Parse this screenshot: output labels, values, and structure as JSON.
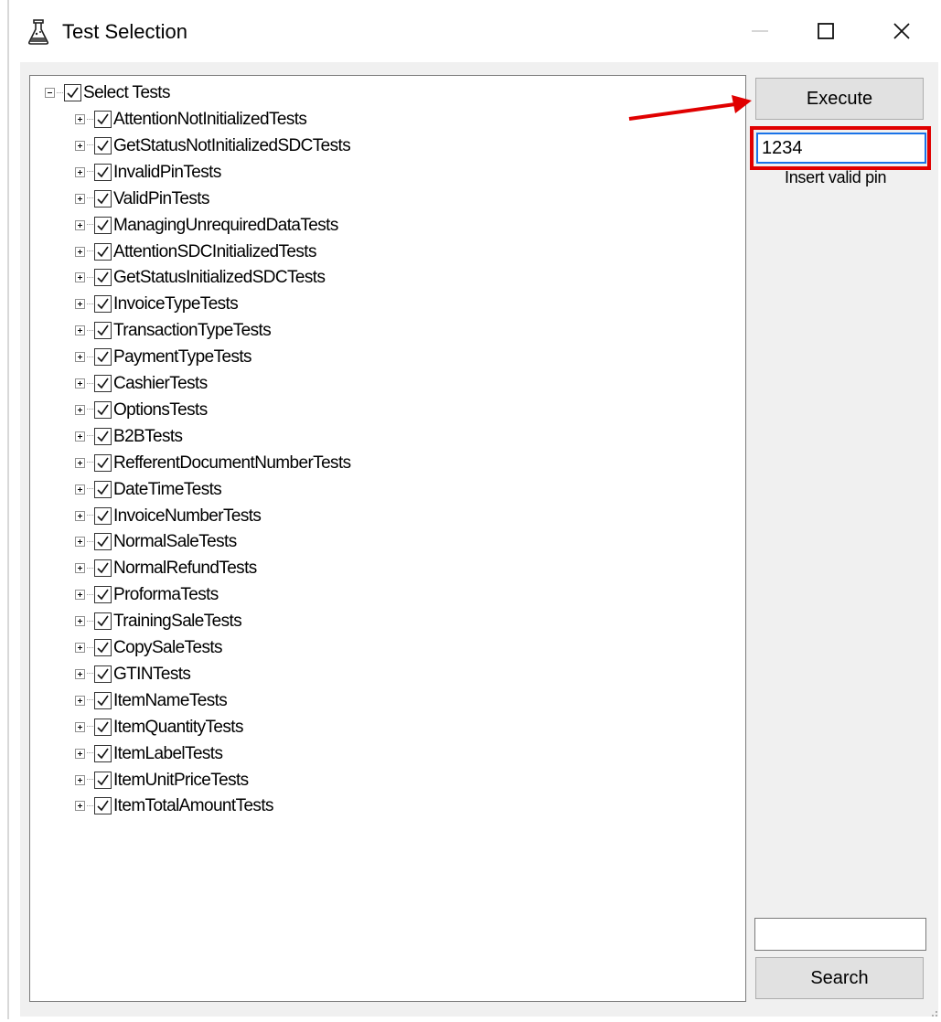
{
  "window": {
    "title": "Test Selection",
    "icon": "test-tube-icon",
    "controls": [
      "minimize-icon",
      "maximize-icon",
      "close-icon"
    ]
  },
  "tree": {
    "root": {
      "label": "Select Tests",
      "checked": true,
      "expanded": true
    },
    "items": [
      {
        "label": "AttentionNotInitializedTests",
        "checked": true
      },
      {
        "label": "GetStatusNotInitializedSDCTests",
        "checked": true
      },
      {
        "label": "InvalidPinTests",
        "checked": true
      },
      {
        "label": "ValidPinTests",
        "checked": true
      },
      {
        "label": "ManagingUnrequiredDataTests",
        "checked": true
      },
      {
        "label": "AttentionSDCInitializedTests",
        "checked": true
      },
      {
        "label": "GetStatusInitializedSDCTests",
        "checked": true
      },
      {
        "label": "InvoiceTypeTests",
        "checked": true
      },
      {
        "label": "TransactionTypeTests",
        "checked": true
      },
      {
        "label": "PaymentTypeTests",
        "checked": true
      },
      {
        "label": "CashierTests",
        "checked": true
      },
      {
        "label": "OptionsTests",
        "checked": true
      },
      {
        "label": "B2BTests",
        "checked": true
      },
      {
        "label": "RefferentDocumentNumberTests",
        "checked": true
      },
      {
        "label": "DateTimeTests",
        "checked": true
      },
      {
        "label": "InvoiceNumberTests",
        "checked": true
      },
      {
        "label": "NormalSaleTests",
        "checked": true
      },
      {
        "label": "NormalRefundTests",
        "checked": true
      },
      {
        "label": "ProformaTests",
        "checked": true
      },
      {
        "label": "TrainingSaleTests",
        "checked": true
      },
      {
        "label": "CopySaleTests",
        "checked": true
      },
      {
        "label": "GTINTests",
        "checked": true
      },
      {
        "label": "ItemNameTests",
        "checked": true
      },
      {
        "label": "ItemQuantityTests",
        "checked": true
      },
      {
        "label": "ItemLabelTests",
        "checked": true
      },
      {
        "label": "ItemUnitPriceTests",
        "checked": true
      },
      {
        "label": "ItemTotalAmountTests",
        "checked": true
      }
    ]
  },
  "panel": {
    "execute_label": "Execute",
    "pin_value": "1234",
    "pin_hint": "Insert valid pin",
    "search_value": "",
    "search_label": "Search"
  },
  "annotations": {
    "highlight_color": "#e00000",
    "arrow_color": "#e00000"
  }
}
